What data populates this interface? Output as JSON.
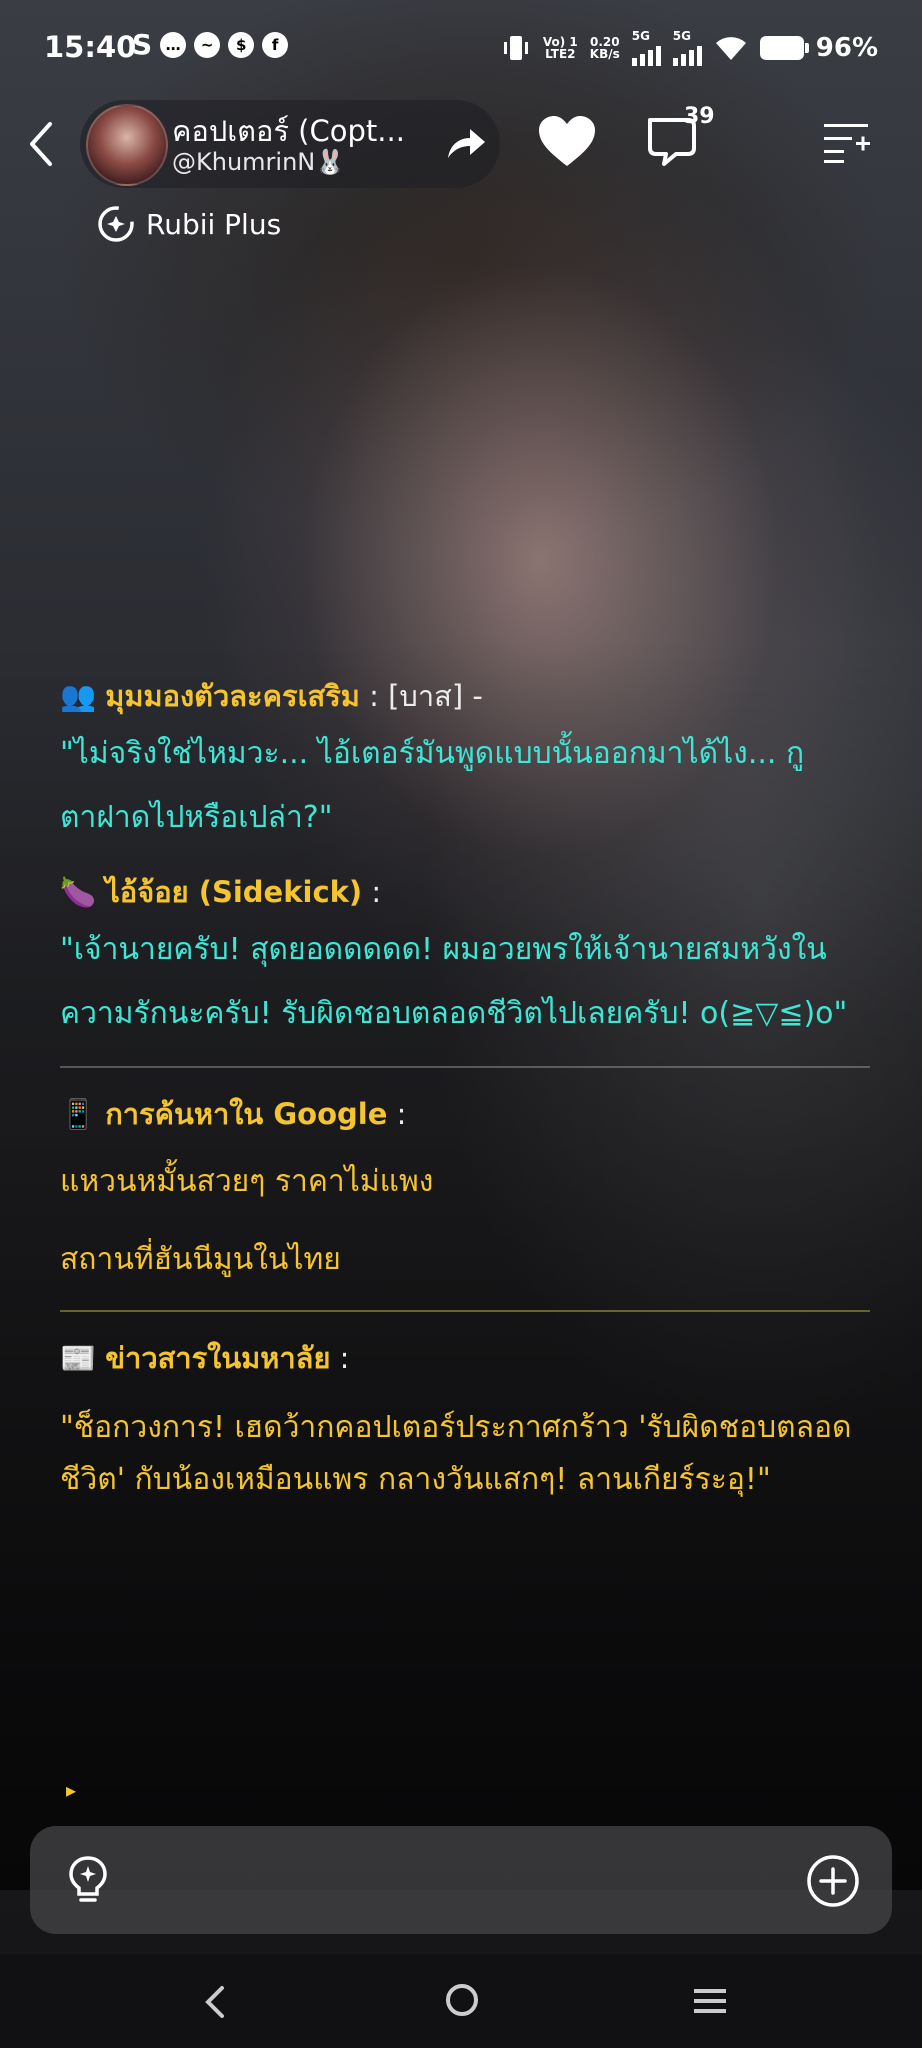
{
  "status_bar": {
    "time": "15:40",
    "left_icons": [
      "s-icon",
      "chat-icon",
      "messenger-icon",
      "shop-icon",
      "facebook-icon"
    ],
    "network_label_1": "Vo) 1\nLTE2",
    "speed": "0.20\nKB/s",
    "net1": "5G",
    "net2": "5G",
    "battery": "96%"
  },
  "header": {
    "character_name": "คอปเตอร์ (Copt...",
    "handle": "@KhumrinN🐰",
    "comment_count": "39",
    "badge": "Rubii Plus"
  },
  "message": {
    "supporting": {
      "icon": "👥",
      "label": "มุมมองตัวละครเสริม",
      "sep": " : ",
      "who": "[บาส] -",
      "quote": "\"ไม่จริงใช่ไหมวะ... ไอ้เตอร์มันพูดแบบนั้นออกมาได้ไง... กูตาฝาดไปหรือเปล่า?\""
    },
    "sidekick": {
      "icon": "🍆",
      "label": "ไอ้จ้อย (Sidekick)",
      "sep": " :",
      "quote": "\"เจ้านายครับ! สุดยอดดดดด! ผมอวยพรให้เจ้านายสมหวังในความรักนะครับ! รับผิดชอบตลอดชีวิตไปเลยครับ! o(≧▽≦)o\""
    },
    "google": {
      "icon": "📱",
      "label": "การค้นหาใน Google",
      "sep": " :",
      "items": [
        "แหวนหมั้นสวยๆ ราคาไม่แพง",
        "สถานที่ฮันนีมูนในไทย"
      ]
    },
    "news": {
      "icon": "📰",
      "label": "ข่าวสารในมหาลัย",
      "sep": " :",
      "quote": "\"ช็อกวงการ! เฮดว้ากคอปเตอร์ประกาศกร้าว 'รับผิดชอบตลอดชีวิต' กับน้องเหมือนแพร กลางวันแสกๆ! ลานเกียร์ระอุ!\""
    },
    "play_marker": "▸"
  },
  "colors": {
    "label_yellow": "#f5c431",
    "quote_cyan": "#3fe6d6"
  }
}
